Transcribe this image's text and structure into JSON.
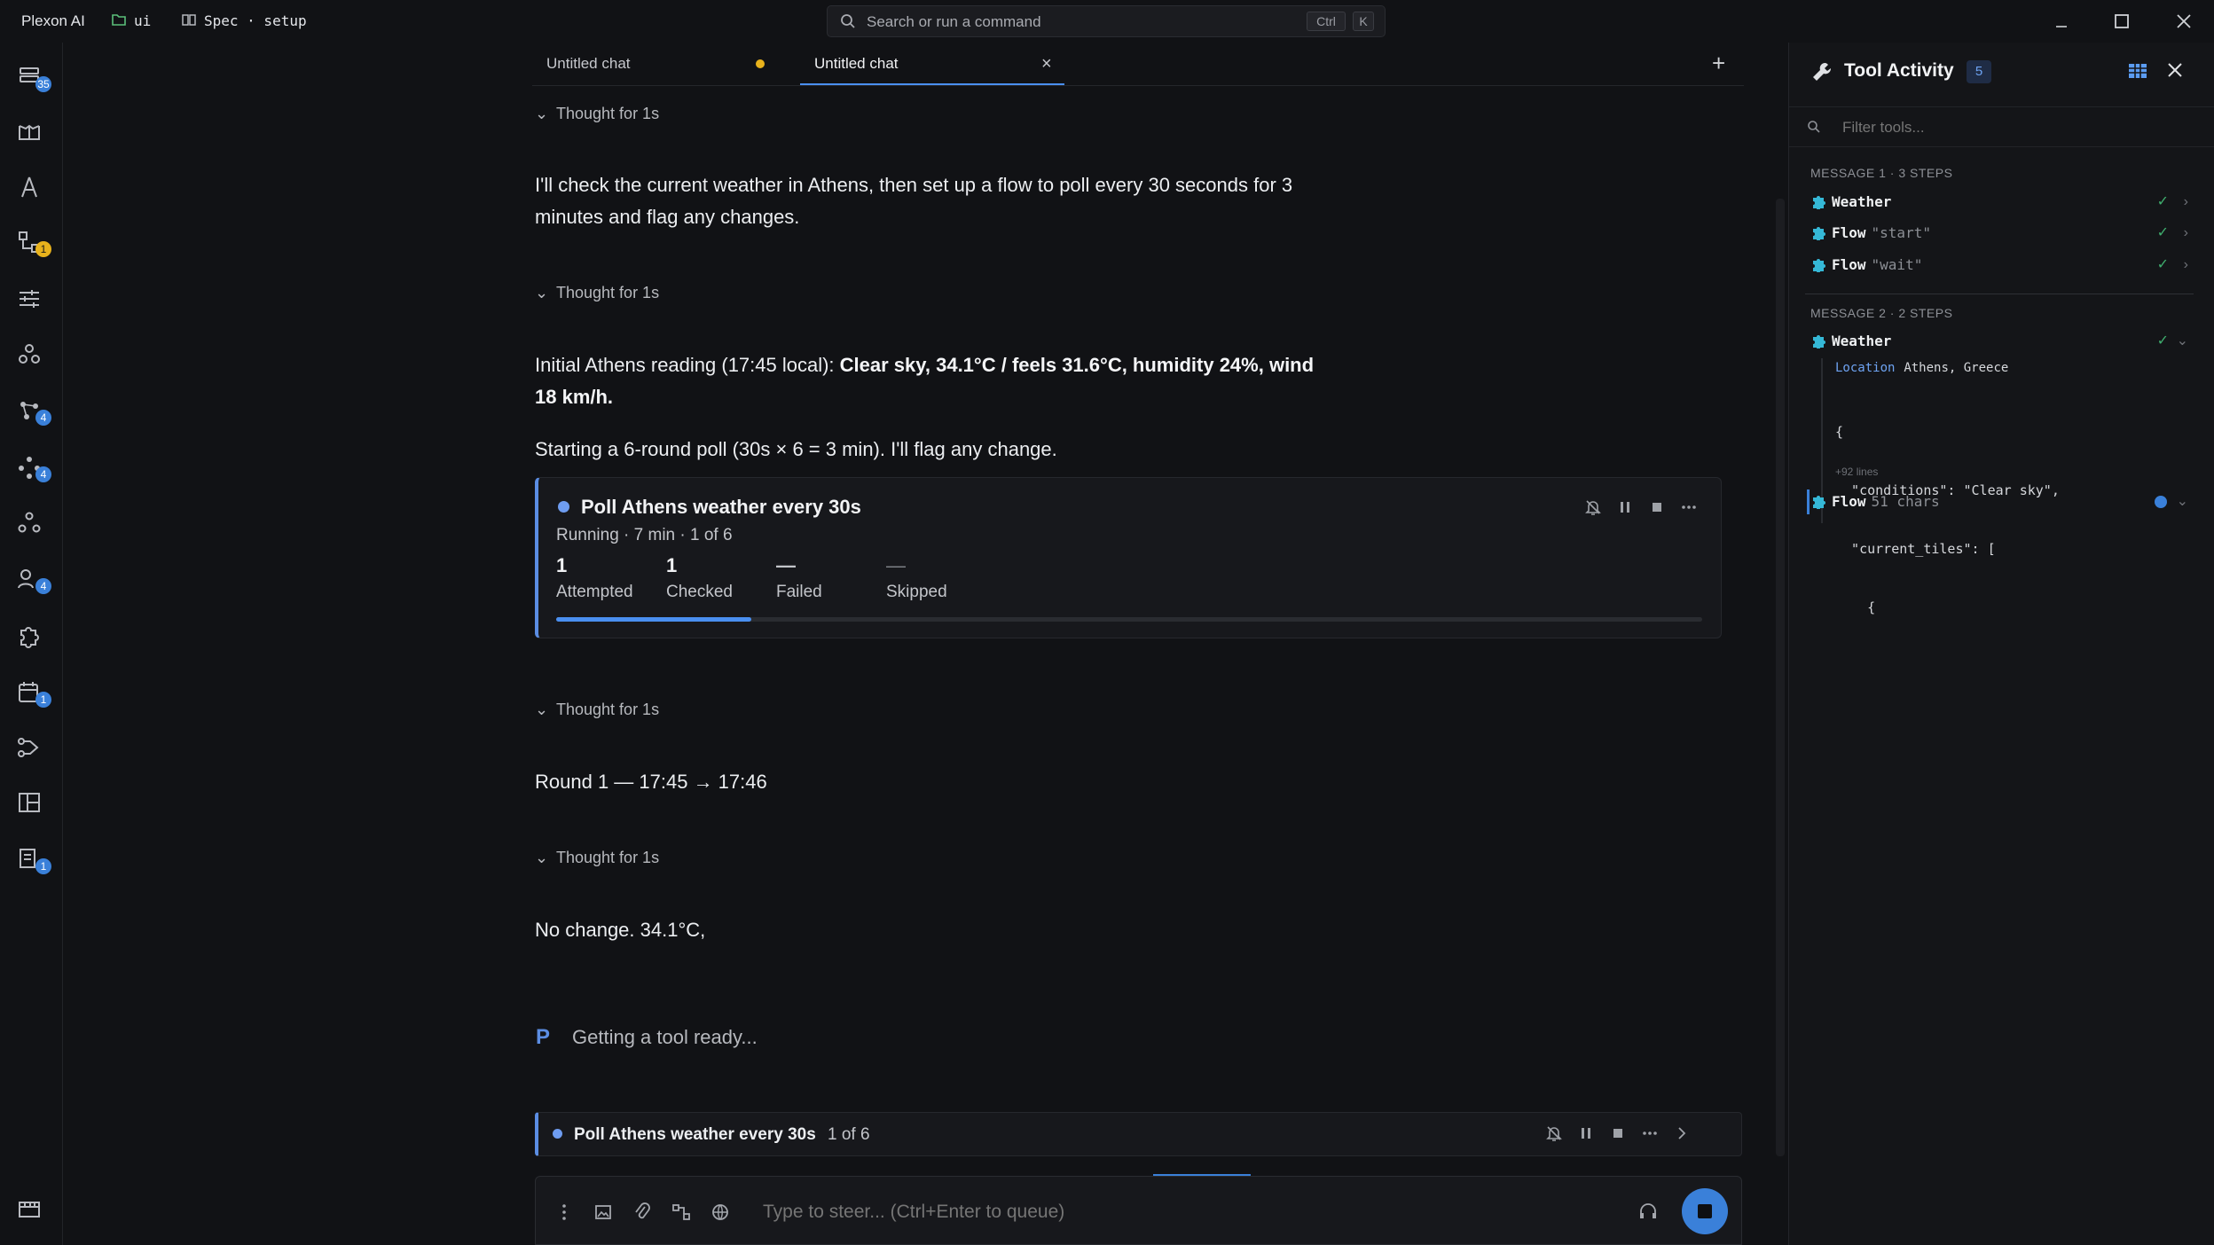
{
  "titlebar": {
    "app_name": "Plexon AI",
    "folder": "ui",
    "spec": "Spec · setup",
    "search_placeholder": "Search or run a command",
    "kbd_ctrl": "Ctrl",
    "kbd_k": "K"
  },
  "rail": {
    "badges": {
      "tasks": "35",
      "graph": "1",
      "nodes": "4",
      "models": "4",
      "agents": "4",
      "calendar": "1",
      "docs": "1"
    }
  },
  "tabs": [
    {
      "label": "Untitled chat",
      "modified": true
    },
    {
      "label": "Untitled chat",
      "active": true
    }
  ],
  "chat": {
    "thought_label": "Thought for 1s",
    "p1": "I'll check the current weather in Athens, then set up a flow to poll every 30 seconds for 3 minutes and flag any changes.",
    "p2_prefix": "Initial Athens reading (17:45 local): ",
    "p2_bold": "Clear sky, 34.1°C / feels 31.6°C, humidity 24%, wind 18 km/h.",
    "p3": "Starting a 6-round poll (30s × 6 = 3 min). I'll flag any change.",
    "round": "Round 1 — 17:45 → 17:46",
    "no_change": "No change. 34.1°C,",
    "status": "Getting a tool ready...",
    "status_logo": "P"
  },
  "poll_card": {
    "title": "Poll Athens weather every 30s",
    "subtitle": "Running · 7 min · 1 of 6",
    "progress": 0.17,
    "accent": "#5b8de3",
    "stats": [
      {
        "value": "1",
        "label": "Attempted"
      },
      {
        "value": "1",
        "label": "Checked"
      },
      {
        "value": "—",
        "label": "Failed"
      },
      {
        "value": "—",
        "label": "Skipped"
      }
    ]
  },
  "poll_bar": {
    "title": "Poll Athens weather every 30s",
    "count": "1 of 6"
  },
  "composer": {
    "placeholder": "Type to steer... (Ctrl+Enter to queue)"
  },
  "panel": {
    "title": "Tool Activity",
    "count": "5",
    "filter_placeholder": "Filter tools...",
    "message1": {
      "header": "MESSAGE 1 · 3 STEPS",
      "items": [
        {
          "name": "Weather",
          "arg": ""
        },
        {
          "name": "Flow",
          "arg": "\"start\""
        },
        {
          "name": "Flow",
          "arg": "\"wait\""
        }
      ]
    },
    "message2": {
      "header": "MESSAGE 2 · 2 STEPS",
      "weather": {
        "name": "Weather",
        "location_label": "Location",
        "location_value": "Athens, Greece",
        "code": [
          "{",
          "  \"conditions\": \"Clear sky\",",
          "  \"current_tiles\": [",
          "    {"
        ],
        "more": "+92 lines"
      },
      "flow": {
        "name": "Flow",
        "arg": "51 chars"
      }
    }
  },
  "colors": {
    "accent": "#3a80d9",
    "success": "#3fae6e",
    "warning": "#e8b21c"
  }
}
